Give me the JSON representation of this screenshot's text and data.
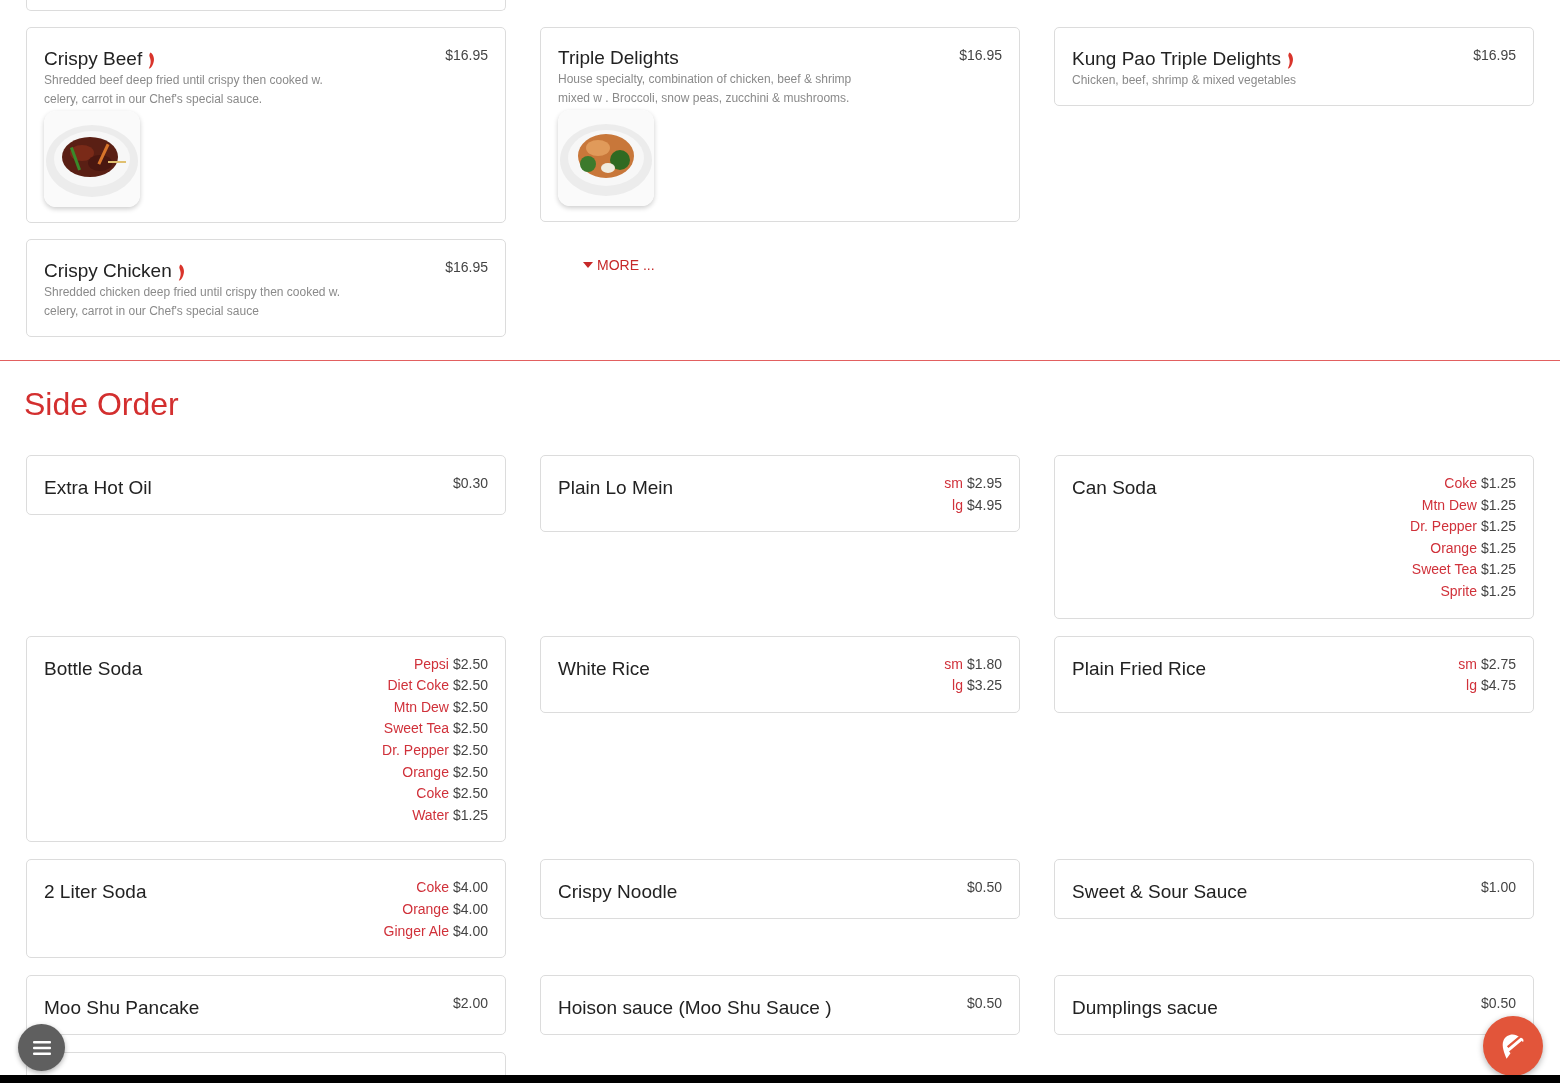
{
  "top_columns": [
    {
      "items": [
        {
          "name": "Crispy Beef",
          "spicy": true,
          "description": "Shredded beef deep fried until crispy then cooked w. celery, carrot in our Chef's special sauce.",
          "prices": [
            {
              "price": "$16.95"
            }
          ],
          "image": {
            "kind": "picture"
          }
        },
        {
          "name": "Crispy Chicken",
          "spicy": true,
          "description": "Shredded chicken deep fried until crispy then cooked w. celery, carrot in our Chef's special sauce",
          "prices": [
            {
              "price": "$16.95"
            }
          ]
        }
      ]
    },
    {
      "items": [
        {
          "name": "Triple Delights",
          "spicy": false,
          "description": "House specialty, combination of chicken, beef & shrimp mixed w . Broccoli, snow peas, zucchini & mushrooms.",
          "prices": [
            {
              "price": "$16.95"
            }
          ],
          "image": {
            "kind": "picture"
          }
        }
      ],
      "more_link": "MORE ..."
    },
    {
      "items": [
        {
          "name": "Kung Pao Triple Delights",
          "spicy": true,
          "description": "Chicken, beef, shrimp & mixed vegetables",
          "prices": [
            {
              "price": "$16.95"
            }
          ]
        }
      ]
    }
  ],
  "section": {
    "title": "Side Order",
    "items": [
      {
        "name": "Extra Hot Oil",
        "spicy": false,
        "prices": [
          {
            "price": "$0.30"
          }
        ]
      },
      {
        "name": "Plain Lo Mein",
        "spicy": false,
        "prices": [
          {
            "size": "sm",
            "price": "$2.95"
          },
          {
            "size": "lg",
            "price": "$4.95"
          }
        ]
      },
      {
        "name": "Can Soda",
        "spicy": false,
        "prices": [
          {
            "size": "Coke",
            "price": "$1.25"
          },
          {
            "size": "Mtn Dew",
            "price": "$1.25"
          },
          {
            "size": "Dr. Pepper",
            "price": "$1.25"
          },
          {
            "size": "Orange",
            "price": "$1.25"
          },
          {
            "size": "Sweet Tea",
            "price": "$1.25"
          },
          {
            "size": "Sprite",
            "price": "$1.25"
          }
        ]
      },
      {
        "name": "Bottle Soda",
        "spicy": false,
        "prices": [
          {
            "size": "Pepsi",
            "price": "$2.50"
          },
          {
            "size": "Diet Coke",
            "price": "$2.50"
          },
          {
            "size": "Mtn Dew",
            "price": "$2.50"
          },
          {
            "size": "Sweet Tea",
            "price": "$2.50"
          },
          {
            "size": "Dr. Pepper",
            "price": "$2.50"
          },
          {
            "size": "Orange",
            "price": "$2.50"
          },
          {
            "size": "Coke",
            "price": "$2.50"
          },
          {
            "size": "Water",
            "price": "$1.25"
          }
        ]
      },
      {
        "name": "White Rice",
        "spicy": false,
        "prices": [
          {
            "size": "sm",
            "price": "$1.80"
          },
          {
            "size": "lg",
            "price": "$3.25"
          }
        ]
      },
      {
        "name": "Plain Fried Rice",
        "spicy": false,
        "prices": [
          {
            "size": "sm",
            "price": "$2.75"
          },
          {
            "size": "lg",
            "price": "$4.75"
          }
        ]
      },
      {
        "name": "2 Liter Soda",
        "spicy": false,
        "prices": [
          {
            "size": "Coke",
            "price": "$4.00"
          },
          {
            "size": "Orange",
            "price": "$4.00"
          },
          {
            "size": "Ginger Ale",
            "price": "$4.00"
          }
        ]
      },
      {
        "name": "Crispy Noodle",
        "spicy": false,
        "prices": [
          {
            "price": "$0.50"
          }
        ]
      },
      {
        "name": "Sweet & Sour Sauce",
        "spicy": false,
        "prices": [
          {
            "price": "$1.00"
          }
        ]
      },
      {
        "name": "Moo Shu Pancake",
        "spicy": false,
        "prices": [
          {
            "price": "$2.00"
          }
        ]
      },
      {
        "name": "Hoison sauce (Moo Shu Sauce   )",
        "spicy": false,
        "prices": [
          {
            "price": "$0.50"
          }
        ]
      },
      {
        "name": "Dumplings sacue",
        "spicy": false,
        "prices": [
          {
            "price": "$0.50"
          }
        ]
      }
    ]
  }
}
